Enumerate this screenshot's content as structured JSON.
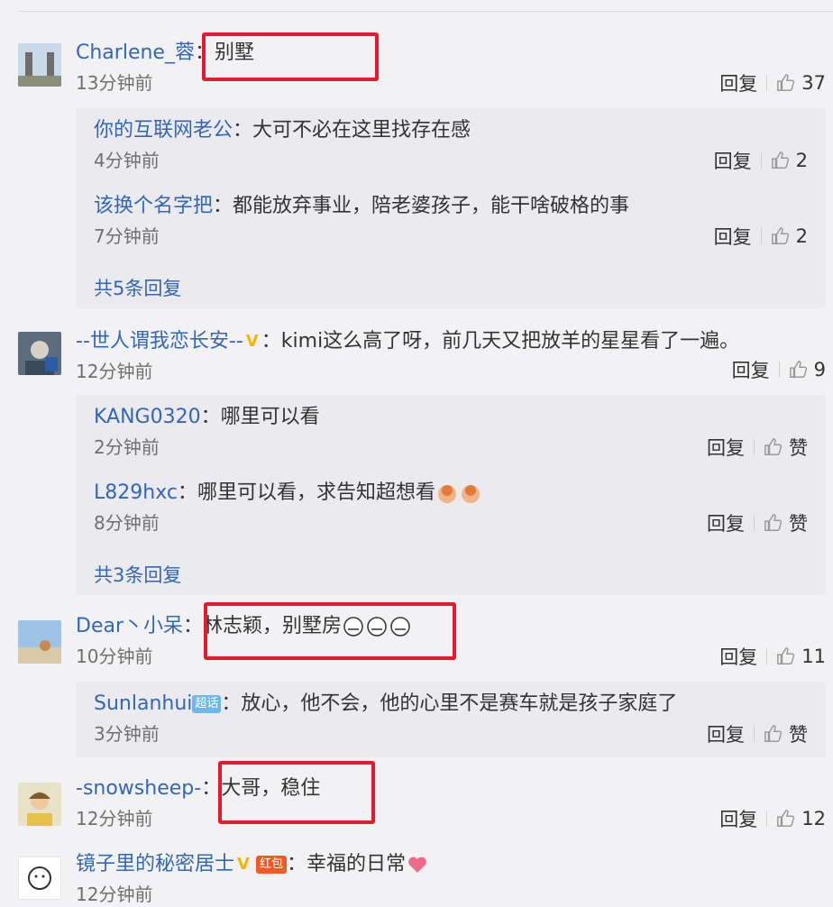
{
  "ui": {
    "reply_label": "回复",
    "more_label_prefix": ""
  },
  "comments": [
    {
      "name": "Charlene_蓉",
      "text": "别墅",
      "time": "13分钟前",
      "likes": "37",
      "replies": [
        {
          "name": "你的互联网老公",
          "text": "大可不必在这里找存在感",
          "time": "4分钟前",
          "likes": "2"
        },
        {
          "name": "该换个名字把",
          "text": "都能放弃事业，陪老婆孩子，能干啥破格的事",
          "time": "7分钟前",
          "likes": "2"
        }
      ],
      "more": "共5条回复"
    },
    {
      "name": "--世人谓我恋长安--",
      "text": "kimi这么高了呀，前几天又把放羊的星星看了一遍。",
      "time": "12分钟前",
      "likes": "9",
      "replies": [
        {
          "name": "KANG0320",
          "text": "哪里可以看",
          "time": "2分钟前",
          "likes": "赞"
        },
        {
          "name": "L829hxc",
          "text": "哪里可以看，求告知超想看",
          "time": "8分钟前",
          "likes": "赞"
        }
      ],
      "more": "共3条回复"
    },
    {
      "name": "Dear丶小呆",
      "text": "林志颖，别墅房",
      "time": "10分钟前",
      "likes": "11",
      "replies": [
        {
          "name": "Sunlanhui",
          "text": "放心，他不会，他的心里不是赛车就是孩子家庭了",
          "time": "3分钟前",
          "likes": "赞",
          "tag": "超话"
        }
      ]
    },
    {
      "name": "-snowsheep-",
      "text": "大哥，稳住",
      "time": "12分钟前",
      "likes": "12"
    },
    {
      "name": "镜子里的秘密居士",
      "text": "幸福的日常",
      "time": "12分钟前",
      "tag": "红包"
    }
  ],
  "colors": {
    "link": "#3366b3",
    "highlight": "#e8192c",
    "background": "#f2f2f5",
    "reply_bg": "#eaeaef"
  },
  "icons": [
    "thumbs-up-icon",
    "verified-v-icon",
    "emoji-icon"
  ]
}
